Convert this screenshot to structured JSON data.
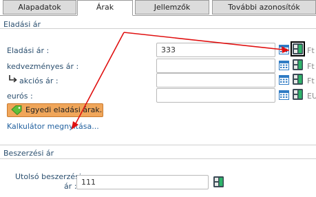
{
  "tabs": [
    {
      "label": "Alapadatok"
    },
    {
      "label": "Árak"
    },
    {
      "label": "Jellemzők"
    },
    {
      "label": "További azonosítók"
    }
  ],
  "eladasi": {
    "section_title": "Eladási ár",
    "rows": [
      {
        "label": "Eladási ár :",
        "value": "333",
        "unit": "Ft"
      },
      {
        "label": "kedvezményes ár :",
        "value": "",
        "unit": "Ft"
      },
      {
        "label": "akciós ár :",
        "value": "",
        "unit": "Ft"
      },
      {
        "label": "eurós :",
        "value": "",
        "unit": "EU"
      }
    ],
    "egyedi_button": "Egyedi eladási árak...",
    "kalkulator_link": "Kalkulátor megnyitása..."
  },
  "beszerzesi": {
    "section_title": "Beszerzési ár",
    "utolso_label_line1": "Utolsó beszerzési",
    "utolso_label_line2": "ár :",
    "utolso_value": "111"
  },
  "icons": {
    "calendar": "calendar-icon",
    "ab": "price-switch-icon",
    "tag": "tag-icon",
    "arrow": "sub-item-arrow-icon"
  },
  "colors": {
    "label_text": "#2a4e6e",
    "link": "#1f5f9e",
    "egyedi_button_bg": "#f0a65a",
    "annotation_arrow": "#e01010",
    "ab_icon_green": "#2eb56a",
    "ab_icon_dark": "#3b4a55"
  }
}
